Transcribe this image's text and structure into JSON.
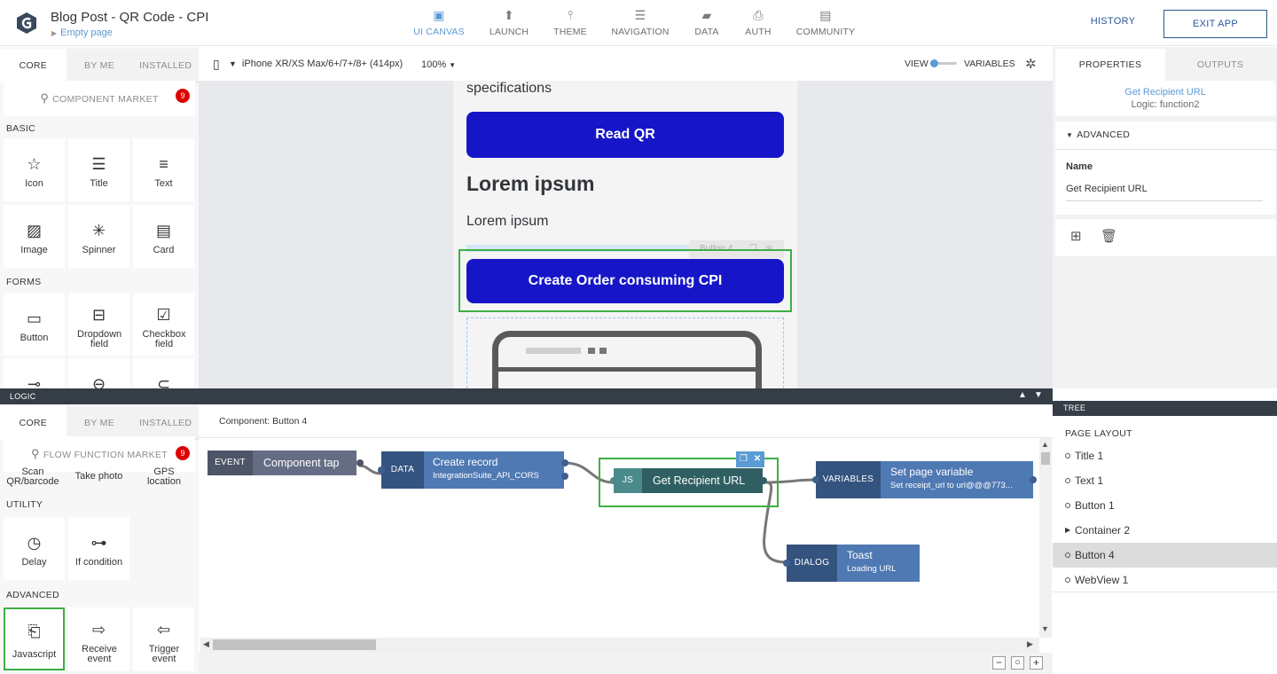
{
  "header": {
    "title": "Blog Post - QR Code - CPI",
    "subtitle": "Empty page",
    "tabs": [
      {
        "label": "UI CANVAS",
        "icon": "ui-canvas-icon"
      },
      {
        "label": "LAUNCH",
        "icon": "launch-icon"
      },
      {
        "label": "THEME",
        "icon": "theme-icon"
      },
      {
        "label": "NAVIGATION",
        "icon": "navigation-icon"
      },
      {
        "label": "DATA",
        "icon": "data-icon"
      },
      {
        "label": "AUTH",
        "icon": "auth-icon"
      },
      {
        "label": "COMMUNITY",
        "icon": "community-icon"
      }
    ],
    "history": "HISTORY",
    "exit": "EXIT APP"
  },
  "palette": {
    "tabs": [
      "CORE",
      "BY ME",
      "INSTALLED"
    ],
    "market": "COMPONENT MARKET",
    "market_badge": "9",
    "basic_label": "BASIC",
    "basic": [
      "Icon",
      "Title",
      "Text",
      "Image",
      "Spinner",
      "Card"
    ],
    "forms_label": "FORMS",
    "forms": [
      "Button",
      "Dropdown field",
      "Checkbox field"
    ]
  },
  "canvasbar": {
    "device": "iPhone XR/XS Max/6+/7+/8+ (414px)",
    "zoom": "100%",
    "view": "VIEW",
    "variables": "VARIABLES"
  },
  "phone": {
    "specs_text": "specifications",
    "read_qr": "Read QR",
    "heading": "Lorem ipsum",
    "body": "Lorem ipsum",
    "selected_label": "Button 4",
    "create_order": "Create Order consuming CPI"
  },
  "properties": {
    "tabs": [
      "PROPERTIES",
      "OUTPUTS"
    ],
    "link": "Get Recipient URL",
    "logic": "Logic: function2",
    "advanced": "ADVANCED",
    "name_label": "Name",
    "name_value": "Get Recipient URL"
  },
  "logic": {
    "bar_label": "LOGIC",
    "tabs": [
      "CORE",
      "BY ME",
      "INSTALLED"
    ],
    "market": "FLOW FUNCTION MARKET",
    "market_badge": "9",
    "partial": [
      "Scan QR/barcode",
      "Take photo",
      "GPS location"
    ],
    "utility_label": "UTILITY",
    "utility": [
      "Delay",
      "If condition"
    ],
    "advanced_label": "ADVANCED",
    "advanced": [
      "Javascript",
      "Receive event",
      "Trigger event"
    ],
    "component": "Component: Button 4"
  },
  "flow": {
    "event": {
      "tag": "EVENT",
      "title": "Component tap"
    },
    "data": {
      "tag": "DATA",
      "title": "Create record",
      "sub": "IntegrationSuite_API_CORS"
    },
    "js": {
      "tag": "JS",
      "title": "Get Recipient URL"
    },
    "variables": {
      "tag": "VARIABLES",
      "title": "Set page variable",
      "sub": "Set receipt_url to url@@@773..."
    },
    "dialog": {
      "tag": "DIALOG",
      "title": "Toast",
      "sub": "Loading URL"
    },
    "colors": {
      "dark": "#34537f",
      "light": "#4f79b3",
      "event_dark": "#4d5566",
      "event_light": "#656d84",
      "js_dark": "#4b8a8a",
      "js_light": "#2f5f63"
    }
  },
  "tree": {
    "bar_label": "TREE",
    "heading": "PAGE LAYOUT",
    "items": [
      "Title 1",
      "Text 1",
      "Button 1",
      "Container 2",
      "Button 4",
      "WebView 1"
    ]
  }
}
